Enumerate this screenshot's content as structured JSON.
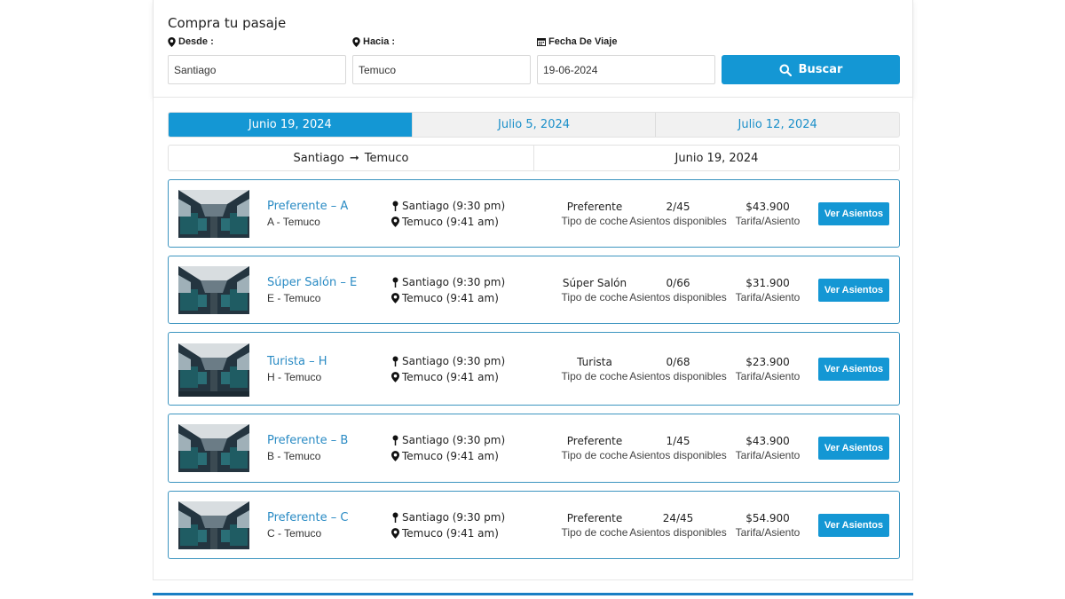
{
  "search": {
    "title": "Compra tu pasaje",
    "desde_label": "Desde :",
    "desde_value": "Santiago",
    "hacia_label": "Hacia :",
    "hacia_value": "Temuco",
    "fecha_label": "Fecha De Viaje",
    "fecha_value": "19-06-2024",
    "button_label": "Buscar"
  },
  "date_tabs": [
    {
      "label": "Junio 19, 2024",
      "active": true
    },
    {
      "label": "Julio 5, 2024",
      "active": false
    },
    {
      "label": "Julio 12, 2024",
      "active": false
    }
  ],
  "route": {
    "origin": "Santiago",
    "arrow": "➞",
    "destination": "Temuco",
    "date": "Junio 19, 2024"
  },
  "column_labels": {
    "type": "Tipo de coche",
    "seats": "Asientos disponibles",
    "price": "Tarifa/Asiento",
    "button": "Ver Asientos"
  },
  "trips": [
    {
      "name": "Preferente – A",
      "sub": "A - Temuco",
      "depart": "Santiago (9:30 pm)",
      "arrive": "Temuco (9:41 am)",
      "type": "Preferente",
      "seats": "2/45",
      "price": "$43.900"
    },
    {
      "name": "Súper Salón – E",
      "sub": "E - Temuco",
      "depart": "Santiago (9:30 pm)",
      "arrive": "Temuco (9:41 am)",
      "type": "Súper Salón",
      "seats": "0/66",
      "price": "$31.900"
    },
    {
      "name": "Turista – H",
      "sub": "H - Temuco",
      "depart": "Santiago (9:30 pm)",
      "arrive": "Temuco (9:41 am)",
      "type": "Turista",
      "seats": "0/68",
      "price": "$23.900"
    },
    {
      "name": "Preferente – B",
      "sub": "B - Temuco",
      "depart": "Santiago (9:30 pm)",
      "arrive": "Temuco (9:41 am)",
      "type": "Preferente",
      "seats": "1/45",
      "price": "$43.900"
    },
    {
      "name": "Preferente – C",
      "sub": "C - Temuco",
      "depart": "Santiago (9:30 pm)",
      "arrive": "Temuco (9:41 am)",
      "type": "Preferente",
      "seats": "24/45",
      "price": "$54.900"
    }
  ],
  "colors": {
    "accent": "#1497d4",
    "link": "#2a8bc4",
    "card_border": "#3d95c0"
  }
}
